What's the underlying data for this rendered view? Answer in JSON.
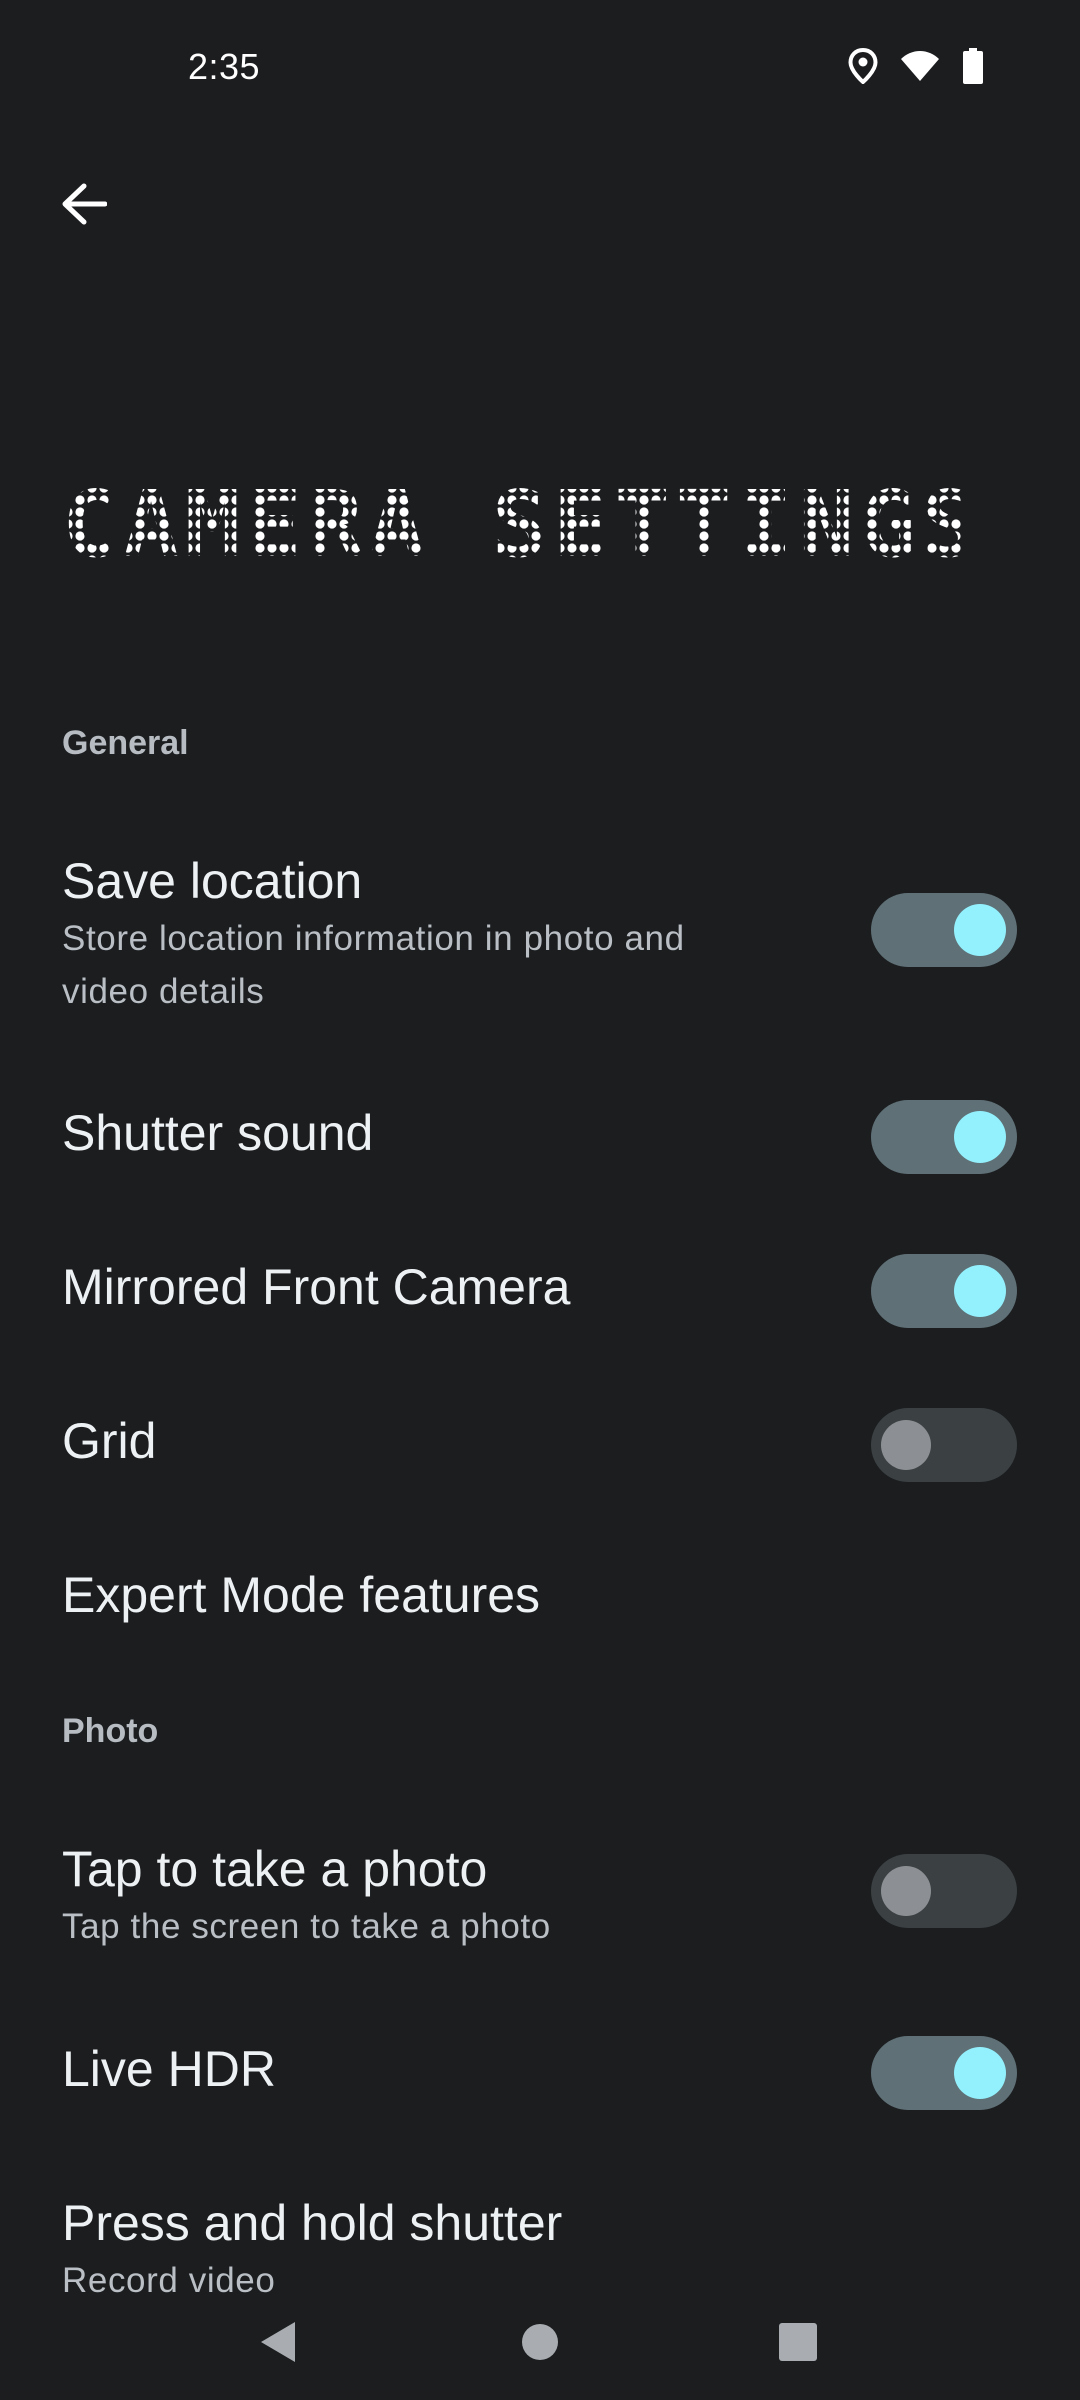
{
  "status_bar": {
    "time": "2:35",
    "icons": [
      "location-icon",
      "wifi-icon",
      "battery-icon"
    ]
  },
  "header": {
    "back_icon": "arrow-left-icon",
    "title": "CAMERA SETTINGS"
  },
  "sections": {
    "general": {
      "label": "General",
      "items": [
        {
          "title": "Save location",
          "summary_line1": "Store location information in photo and",
          "summary_line2": "video details",
          "enabled": true
        },
        {
          "title": "Shutter sound",
          "enabled": true
        },
        {
          "title": "Mirrored Front Camera",
          "enabled": true
        },
        {
          "title": "Grid",
          "enabled": false
        },
        {
          "title": "Expert Mode features"
        }
      ]
    },
    "photo": {
      "label": "Photo",
      "items": [
        {
          "title": "Tap to take a photo",
          "summary": "Tap the screen to take a photo",
          "enabled": false
        },
        {
          "title": "Live HDR",
          "enabled": true
        },
        {
          "title": "Press and hold shutter",
          "summary": "Record video"
        }
      ]
    }
  },
  "nav_bar": {
    "buttons": [
      "back-triangle-icon",
      "home-circle-icon",
      "recents-square-icon"
    ]
  },
  "colors": {
    "background": "#1b1d1f",
    "toggle_on_track": "#5f7177",
    "toggle_on_knob": "#93f0fd",
    "toggle_off_track": "#3b4042",
    "toggle_off_knob": "#8c9094"
  }
}
